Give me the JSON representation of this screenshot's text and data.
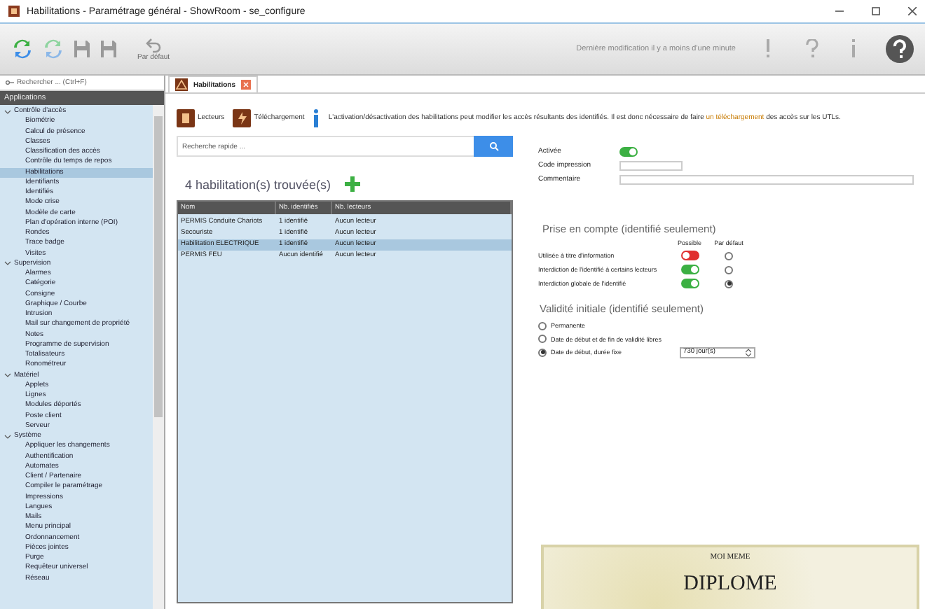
{
  "window": {
    "title": "Habilitations - Paramétrage général - ShowRoom - se_configure"
  },
  "toolbar": {
    "default_label": "Par défaut",
    "status": "Dernière modification il y a moins d'une minute"
  },
  "sidebar": {
    "search_placeholder": "Rechercher ... (Ctrl+F)",
    "header": "Applications",
    "tree": [
      {
        "label": "Contrôle d'accès",
        "expanded": true,
        "children": [
          {
            "label": "Biométrie",
            "selected": false
          },
          {
            "label": "Calcul de présence",
            "selected": false
          },
          {
            "label": "Classes",
            "selected": false
          },
          {
            "label": "Classification des accès",
            "selected": false
          },
          {
            "label": "Contrôle du temps de repos",
            "selected": false
          },
          {
            "label": "Habilitations",
            "selected": true
          },
          {
            "label": "Identifiants",
            "selected": false
          },
          {
            "label": "Identifiés",
            "selected": false
          },
          {
            "label": "Mode crise",
            "selected": false
          },
          {
            "label": "Modèle de carte",
            "selected": false
          },
          {
            "label": "Plan d'opération interne (POI)",
            "selected": false
          },
          {
            "label": "Rondes",
            "selected": false
          },
          {
            "label": "Trace badge",
            "selected": false
          },
          {
            "label": "Visites",
            "selected": false
          }
        ]
      },
      {
        "label": "Supervision",
        "expanded": true,
        "children": [
          {
            "label": "Alarmes",
            "selected": false
          },
          {
            "label": "Catégorie",
            "selected": false
          },
          {
            "label": "Consigne",
            "selected": false
          },
          {
            "label": "Graphique / Courbe",
            "selected": false
          },
          {
            "label": "Intrusion",
            "selected": false
          },
          {
            "label": "Mail sur changement de propriété",
            "selected": false
          },
          {
            "label": "Notes",
            "selected": false
          },
          {
            "label": "Programme de supervision",
            "selected": false
          },
          {
            "label": "Totalisateurs",
            "selected": false
          },
          {
            "label": "Ronométreur",
            "selected": false
          }
        ]
      },
      {
        "label": "Matériel",
        "expanded": true,
        "children": [
          {
            "label": "Applets",
            "selected": false
          },
          {
            "label": "Lignes",
            "selected": false
          },
          {
            "label": "Modules déportés",
            "selected": false
          },
          {
            "label": "Poste client",
            "selected": false
          },
          {
            "label": "Serveur",
            "selected": false
          }
        ]
      },
      {
        "label": "Système",
        "expanded": true,
        "children": [
          {
            "label": "Appliquer les changements",
            "selected": false
          },
          {
            "label": "Authentification",
            "selected": false
          },
          {
            "label": "Automates",
            "selected": false
          },
          {
            "label": "Client / Partenaire",
            "selected": false
          },
          {
            "label": "Compiler le paramétrage",
            "selected": false
          },
          {
            "label": "Impressions",
            "selected": false
          },
          {
            "label": "Langues",
            "selected": false
          },
          {
            "label": "Mails",
            "selected": false
          },
          {
            "label": "Menu principal",
            "selected": false
          },
          {
            "label": "Ordonnancement",
            "selected": false
          },
          {
            "label": "Pièces jointes",
            "selected": false
          },
          {
            "label": "Purge",
            "selected": false
          },
          {
            "label": "Requêteur universel",
            "selected": false
          },
          {
            "label": "Réseau",
            "selected": false
          }
        ]
      }
    ]
  },
  "tab": {
    "label": "Habilitations",
    "selected": true
  },
  "actions": [
    "Lecteurs",
    "Téléchargement"
  ],
  "info": {
    "before": "L'activation/désactivation des habilitations peut modifier les accès résultants des identifiés. Il est donc nécessaire de faire",
    "link": "un téléchargement",
    "after": "des accès sur les UTLs."
  },
  "quick_search": {
    "placeholder": "Recherche rapide ..."
  },
  "count": "4 habilitation(s) trouvée(s)",
  "table": {
    "columns": [
      "Nom",
      "Nb. identifiés",
      "Nb. lecteurs"
    ],
    "rows": [
      {
        "cells": [
          "PERMIS Conduite Chariots",
          "1 identifié",
          "Aucun lecteur"
        ],
        "selected": false
      },
      {
        "cells": [
          "Secouriste",
          "1 identifié",
          "Aucun lecteur"
        ],
        "selected": false
      },
      {
        "cells": [
          "Habilitation ELECTRIQUE",
          "1 identifié",
          "Aucun lecteur"
        ],
        "selected": true
      },
      {
        "cells": [
          "PERMIS FEU",
          "Aucun identifié",
          "Aucun lecteur"
        ],
        "selected": false
      }
    ]
  },
  "form": {
    "active": {
      "label": "Activée",
      "on": true
    },
    "code": {
      "label": "Code impression"
    },
    "comment": {
      "label": "Commentaire"
    }
  },
  "consideration": {
    "title": "Prise en compte (identifié seulement)",
    "columns": [
      "Possible",
      "Par défaut"
    ],
    "rows": [
      {
        "label": "Utilisée à titre d'information",
        "on": false,
        "selected": false
      },
      {
        "label": "Interdiction de l'identifié à certains lecteurs",
        "on": true,
        "selected": false
      },
      {
        "label": "Interdiction globale de l'identifié",
        "on": true,
        "selected": true
      }
    ]
  },
  "validity": {
    "title": "Validité initiale (identifié seulement)",
    "options": [
      {
        "label": "Permanente",
        "selected": false
      },
      {
        "label": "Date de début et de fin de validité libres",
        "selected": false
      },
      {
        "label": "Date de début, durée fixe",
        "selected": true,
        "duration": "730 jour(s)"
      }
    ]
  },
  "diploma": {
    "name": "MOI MEME",
    "title": "DIPLOME"
  }
}
